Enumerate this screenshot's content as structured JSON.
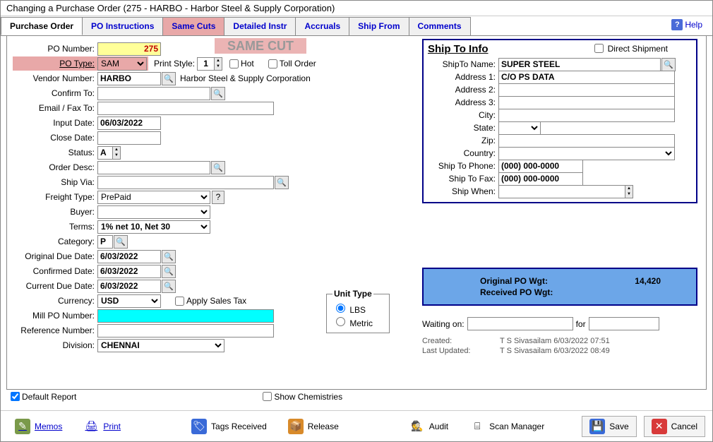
{
  "window": {
    "title": "Changing a Purchase Order  (275 - HARBO - Harbor Steel & Supply Corporation)"
  },
  "tabs": [
    {
      "label": "Purchase Order",
      "active": true
    },
    {
      "label": "PO Instructions"
    },
    {
      "label": "Same Cuts",
      "pink": true
    },
    {
      "label": "Detailed Instr"
    },
    {
      "label": "Accruals"
    },
    {
      "label": "Ship From"
    },
    {
      "label": "Comments"
    }
  ],
  "help": "Help",
  "stamp": "SAME CUT",
  "form": {
    "po_number_label": "PO Number:",
    "po_number": "275",
    "po_type_label": "PO Type:",
    "po_type": "SAM",
    "print_style_label": "Print Style:",
    "print_style": "1",
    "hot_label": "Hot",
    "toll_label": "Toll Order",
    "vendor_number_label": "Vendor Number:",
    "vendor_number": "HARBO",
    "vendor_name": "Harbor Steel & Supply Corporation",
    "confirm_to_label": "Confirm To:",
    "confirm_to": "",
    "email_fax_label": "Email / Fax To:",
    "email_fax": "",
    "input_date_label": "Input Date:",
    "input_date": "06/03/2022",
    "close_date_label": "Close Date:",
    "close_date": "",
    "status_label": "Status:",
    "status": "A",
    "order_desc_label": "Order Desc:",
    "order_desc": "",
    "ship_via_label": "Ship Via:",
    "ship_via": "",
    "freight_type_label": "Freight Type:",
    "freight_type": "PrePaid",
    "buyer_label": "Buyer:",
    "buyer": "",
    "terms_label": "Terms:",
    "terms": "1% net 10, Net 30",
    "category_label": "Category:",
    "category": "P",
    "orig_due_label": "Original Due Date:",
    "orig_due": "6/03/2022",
    "conf_date_label": "Confirmed Date:",
    "conf_date": "6/03/2022",
    "curr_due_label": "Current Due Date:",
    "curr_due": "6/03/2022",
    "currency_label": "Currency:",
    "currency": "USD",
    "apply_tax_label": "Apply Sales Tax",
    "mill_po_label": "Mill PO Number:",
    "mill_po": "",
    "ref_num_label": "Reference Number:",
    "ref_num": "",
    "division_label": "Division:",
    "division": "CHENNAI"
  },
  "unit_type": {
    "legend": "Unit Type",
    "lbs": "LBS",
    "metric": "Metric",
    "selected": "LBS"
  },
  "shipto": {
    "title": "Ship To Info",
    "direct_label": "Direct Shipment",
    "name_label": "ShipTo Name:",
    "name": "SUPER STEEL",
    "addr1_label": "Address 1:",
    "addr1": "C/O PS DATA",
    "addr2_label": "Address 2:",
    "addr2": "",
    "addr3_label": "Address 3:",
    "addr3": "",
    "city_label": "City:",
    "city": "",
    "state_label": "State:",
    "state": "",
    "zip_label": "Zip:",
    "zip": "",
    "country_label": "Country:",
    "country": "",
    "phone_label": "Ship To Phone:",
    "phone": "(000) 000-0000",
    "fax_label": "Ship To Fax:",
    "fax": "(000) 000-0000",
    "when_label": "Ship When:",
    "when": ""
  },
  "wgt": {
    "orig_label": "Original PO Wgt:",
    "orig": "14,420",
    "recv_label": "Received PO Wgt:",
    "recv": ""
  },
  "waiting": {
    "label": "Waiting on:",
    "for": "for"
  },
  "meta": {
    "created_label": "Created:",
    "created": "T S Sivasailam 6/03/2022 07:51",
    "updated_label": "Last Updated:",
    "updated": "T S Sivasailam 6/03/2022 08:49"
  },
  "checks": {
    "default_report": "Default Report",
    "show_chem": "Show Chemistries"
  },
  "toolbar": {
    "memos": "Memos",
    "print": "Print",
    "tags": "Tags Received",
    "release": "Release",
    "audit": "Audit",
    "scan": "Scan Manager",
    "save": "Save",
    "cancel": "Cancel"
  }
}
